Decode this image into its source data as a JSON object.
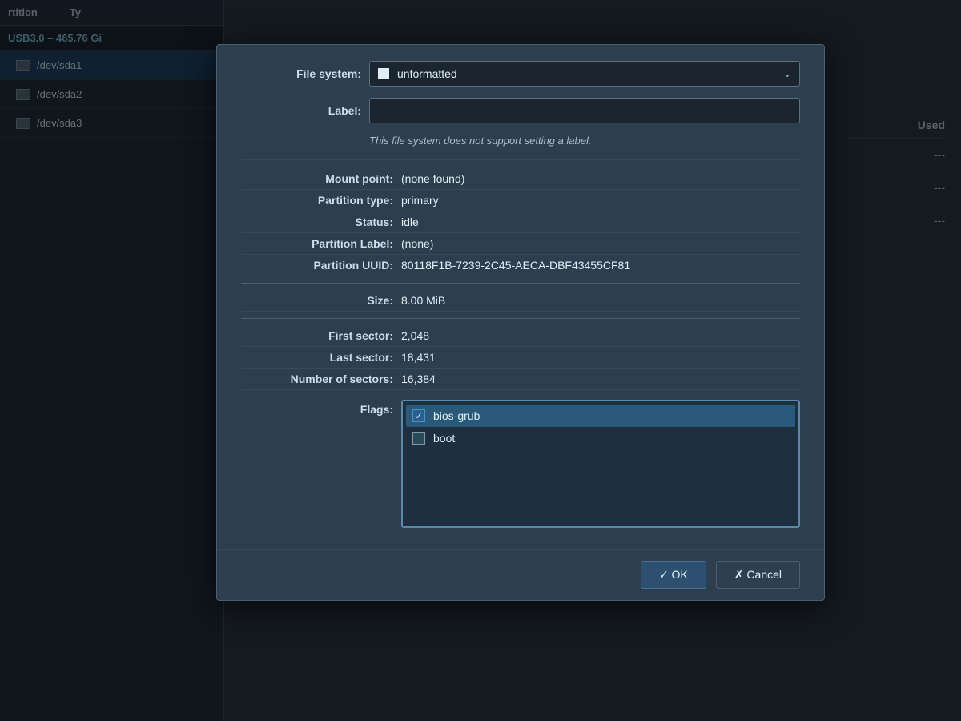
{
  "background": {
    "header": {
      "partition_col": "rtition",
      "type_col": "Ty",
      "used_col": "Used"
    },
    "device": {
      "label": "USB3.0 – 465.76 Gi"
    },
    "partitions": [
      {
        "name": "/dev/sda1",
        "selected": true,
        "used": "---"
      },
      {
        "name": "/dev/sda2",
        "selected": false,
        "used": "---"
      },
      {
        "name": "/dev/sda3",
        "selected": false,
        "used": "---"
      }
    ]
  },
  "dialog": {
    "filesystem": {
      "label": "File system:",
      "value": "unformatted",
      "dropdown_open": false
    },
    "label_field": {
      "label": "Label:",
      "value": "",
      "placeholder": ""
    },
    "hint": "This file system does not support setting a label.",
    "mount_point": {
      "label": "Mount point:",
      "value": "(none found)"
    },
    "partition_type": {
      "label": "Partition type:",
      "value": "primary"
    },
    "status": {
      "label": "Status:",
      "value": "idle"
    },
    "partition_label": {
      "label": "Partition Label:",
      "value": "(none)"
    },
    "partition_uuid": {
      "label": "Partition UUID:",
      "value": "80118F1B-7239-2C45-AECA-DBF43455CF81"
    },
    "size": {
      "label": "Size:",
      "value": "8.00 MiB"
    },
    "first_sector": {
      "label": "First sector:",
      "value": "2,048"
    },
    "last_sector": {
      "label": "Last sector:",
      "value": "18,431"
    },
    "number_of_sectors": {
      "label": "Number of sectors:",
      "value": "16,384"
    },
    "flags": {
      "label": "Flags:",
      "items": [
        {
          "name": "bios-grub",
          "checked": true
        },
        {
          "name": "boot",
          "checked": false
        }
      ]
    },
    "buttons": {
      "ok": "✓ OK",
      "cancel": "✗ Cancel"
    }
  }
}
